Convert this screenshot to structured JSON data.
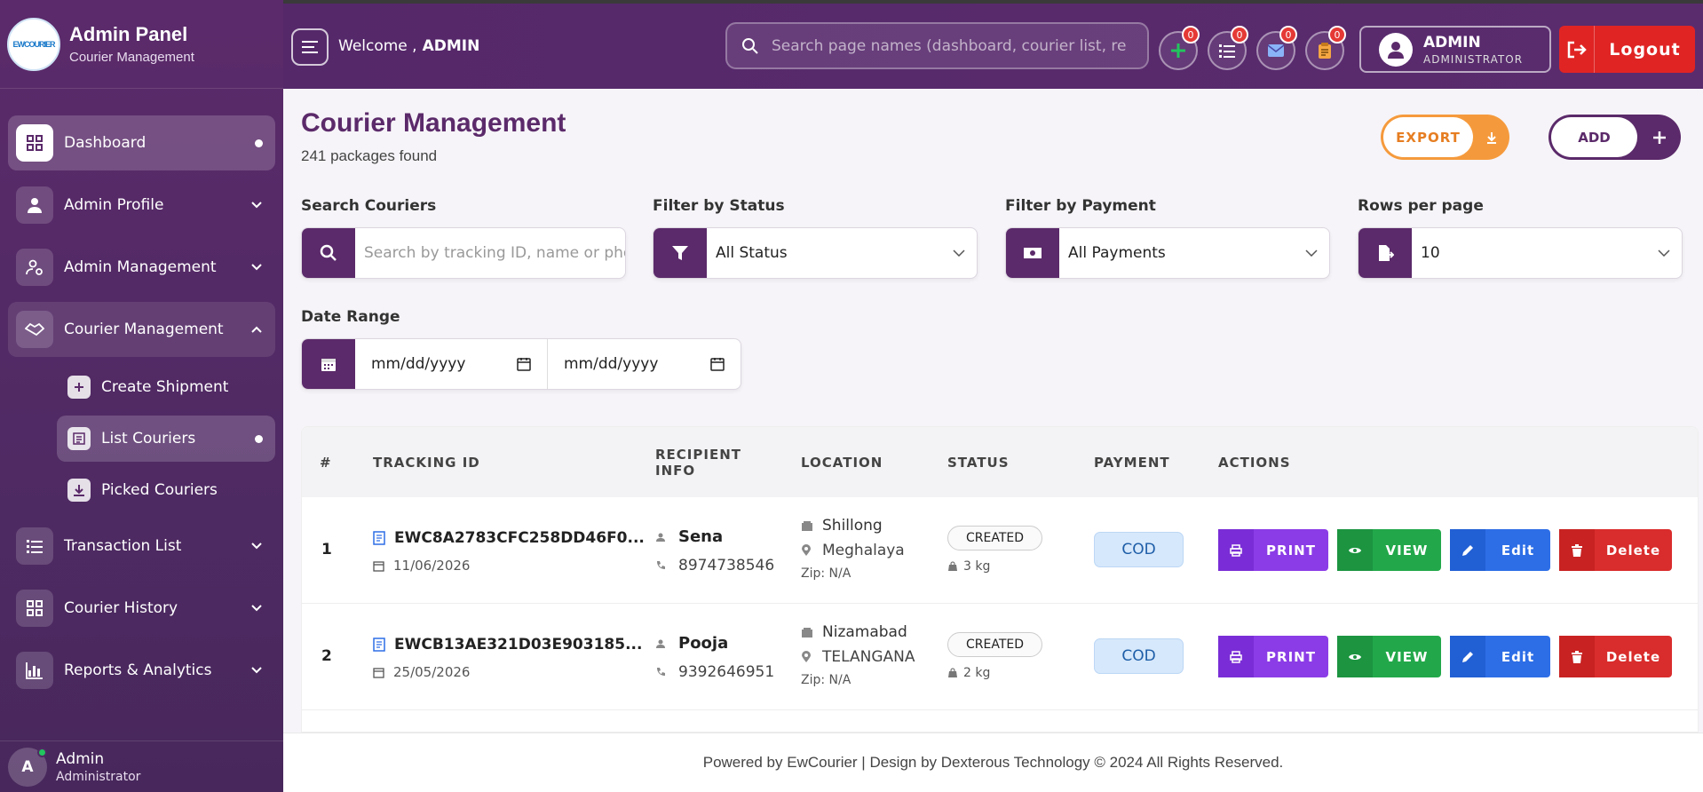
{
  "brand": {
    "logo_text": "EWCOURIER",
    "title": "Admin Panel",
    "subtitle": "Courier Management"
  },
  "sidebar": {
    "items": [
      {
        "label": "Dashboard"
      },
      {
        "label": "Admin Profile"
      },
      {
        "label": "Admin Management"
      },
      {
        "label": "Courier Management"
      },
      {
        "label": "Transaction List"
      },
      {
        "label": "Courier History"
      },
      {
        "label": "Reports & Analytics"
      }
    ],
    "sub_items": [
      {
        "label": "Create Shipment"
      },
      {
        "label": "List Couriers"
      },
      {
        "label": "Picked Couriers"
      }
    ],
    "user": {
      "initial": "A",
      "name": "Admin",
      "role": "Administrator"
    }
  },
  "topbar": {
    "welcome": "Welcome ,",
    "welcome_user": "ADMIN",
    "search_placeholder": "Search page names (dashboard, courier list, reports...)",
    "badges": [
      "0",
      "0",
      "0",
      "0"
    ],
    "user_name": "ADMIN",
    "user_role": "ADMINISTRATOR",
    "logout_label": "Logout"
  },
  "page": {
    "title": "Courier Management",
    "subtitle": "241 packages found",
    "export_label": "EXPORT",
    "add_label": "ADD"
  },
  "filters": {
    "search_label": "Search Couriers",
    "search_placeholder": "Search by tracking ID, name or phone",
    "status_label": "Filter by Status",
    "status_value": "All Status",
    "payment_label": "Filter by Payment",
    "payment_value": "All Payments",
    "rows_label": "Rows per page",
    "rows_value": "10",
    "date_label": "Date Range",
    "date_from": "mm/dd/yyyy",
    "date_to": "mm/dd/yyyy"
  },
  "table": {
    "headers": {
      "num": "#",
      "tracking": "TRACKING ID",
      "recipient_1": "RECIPIENT",
      "recipient_2": "INFO",
      "location": "LOCATION",
      "status": "STATUS",
      "payment": "PAYMENT",
      "actions": "ACTIONS"
    },
    "action_labels": {
      "print": "PRINT",
      "view": "VIEW",
      "edit": "Edit",
      "delete": "Delete"
    },
    "rows": [
      {
        "num": "1",
        "tracking_id": "EWC8A2783CFC258DD46F0...",
        "date": "11/06/2026",
        "name": "Sena",
        "phone": "8974738546",
        "city": "Shillong",
        "state": "Meghalaya",
        "zip": "Zip: N/A",
        "status": "CREATED",
        "weight": "3 kg",
        "payment": "COD"
      },
      {
        "num": "2",
        "tracking_id": "EWCB13AE321D03E903185...",
        "date": "25/05/2026",
        "name": "Pooja",
        "phone": "9392646951",
        "city": "Nizamabad",
        "state": "TELANGANA",
        "zip": "Zip: N/A",
        "status": "CREATED",
        "weight": "2 kg",
        "payment": "COD"
      }
    ]
  },
  "footer": {
    "text": "Powered by EwCourier | Design by Dexterous Technology © 2024 All Rights Reserved."
  }
}
